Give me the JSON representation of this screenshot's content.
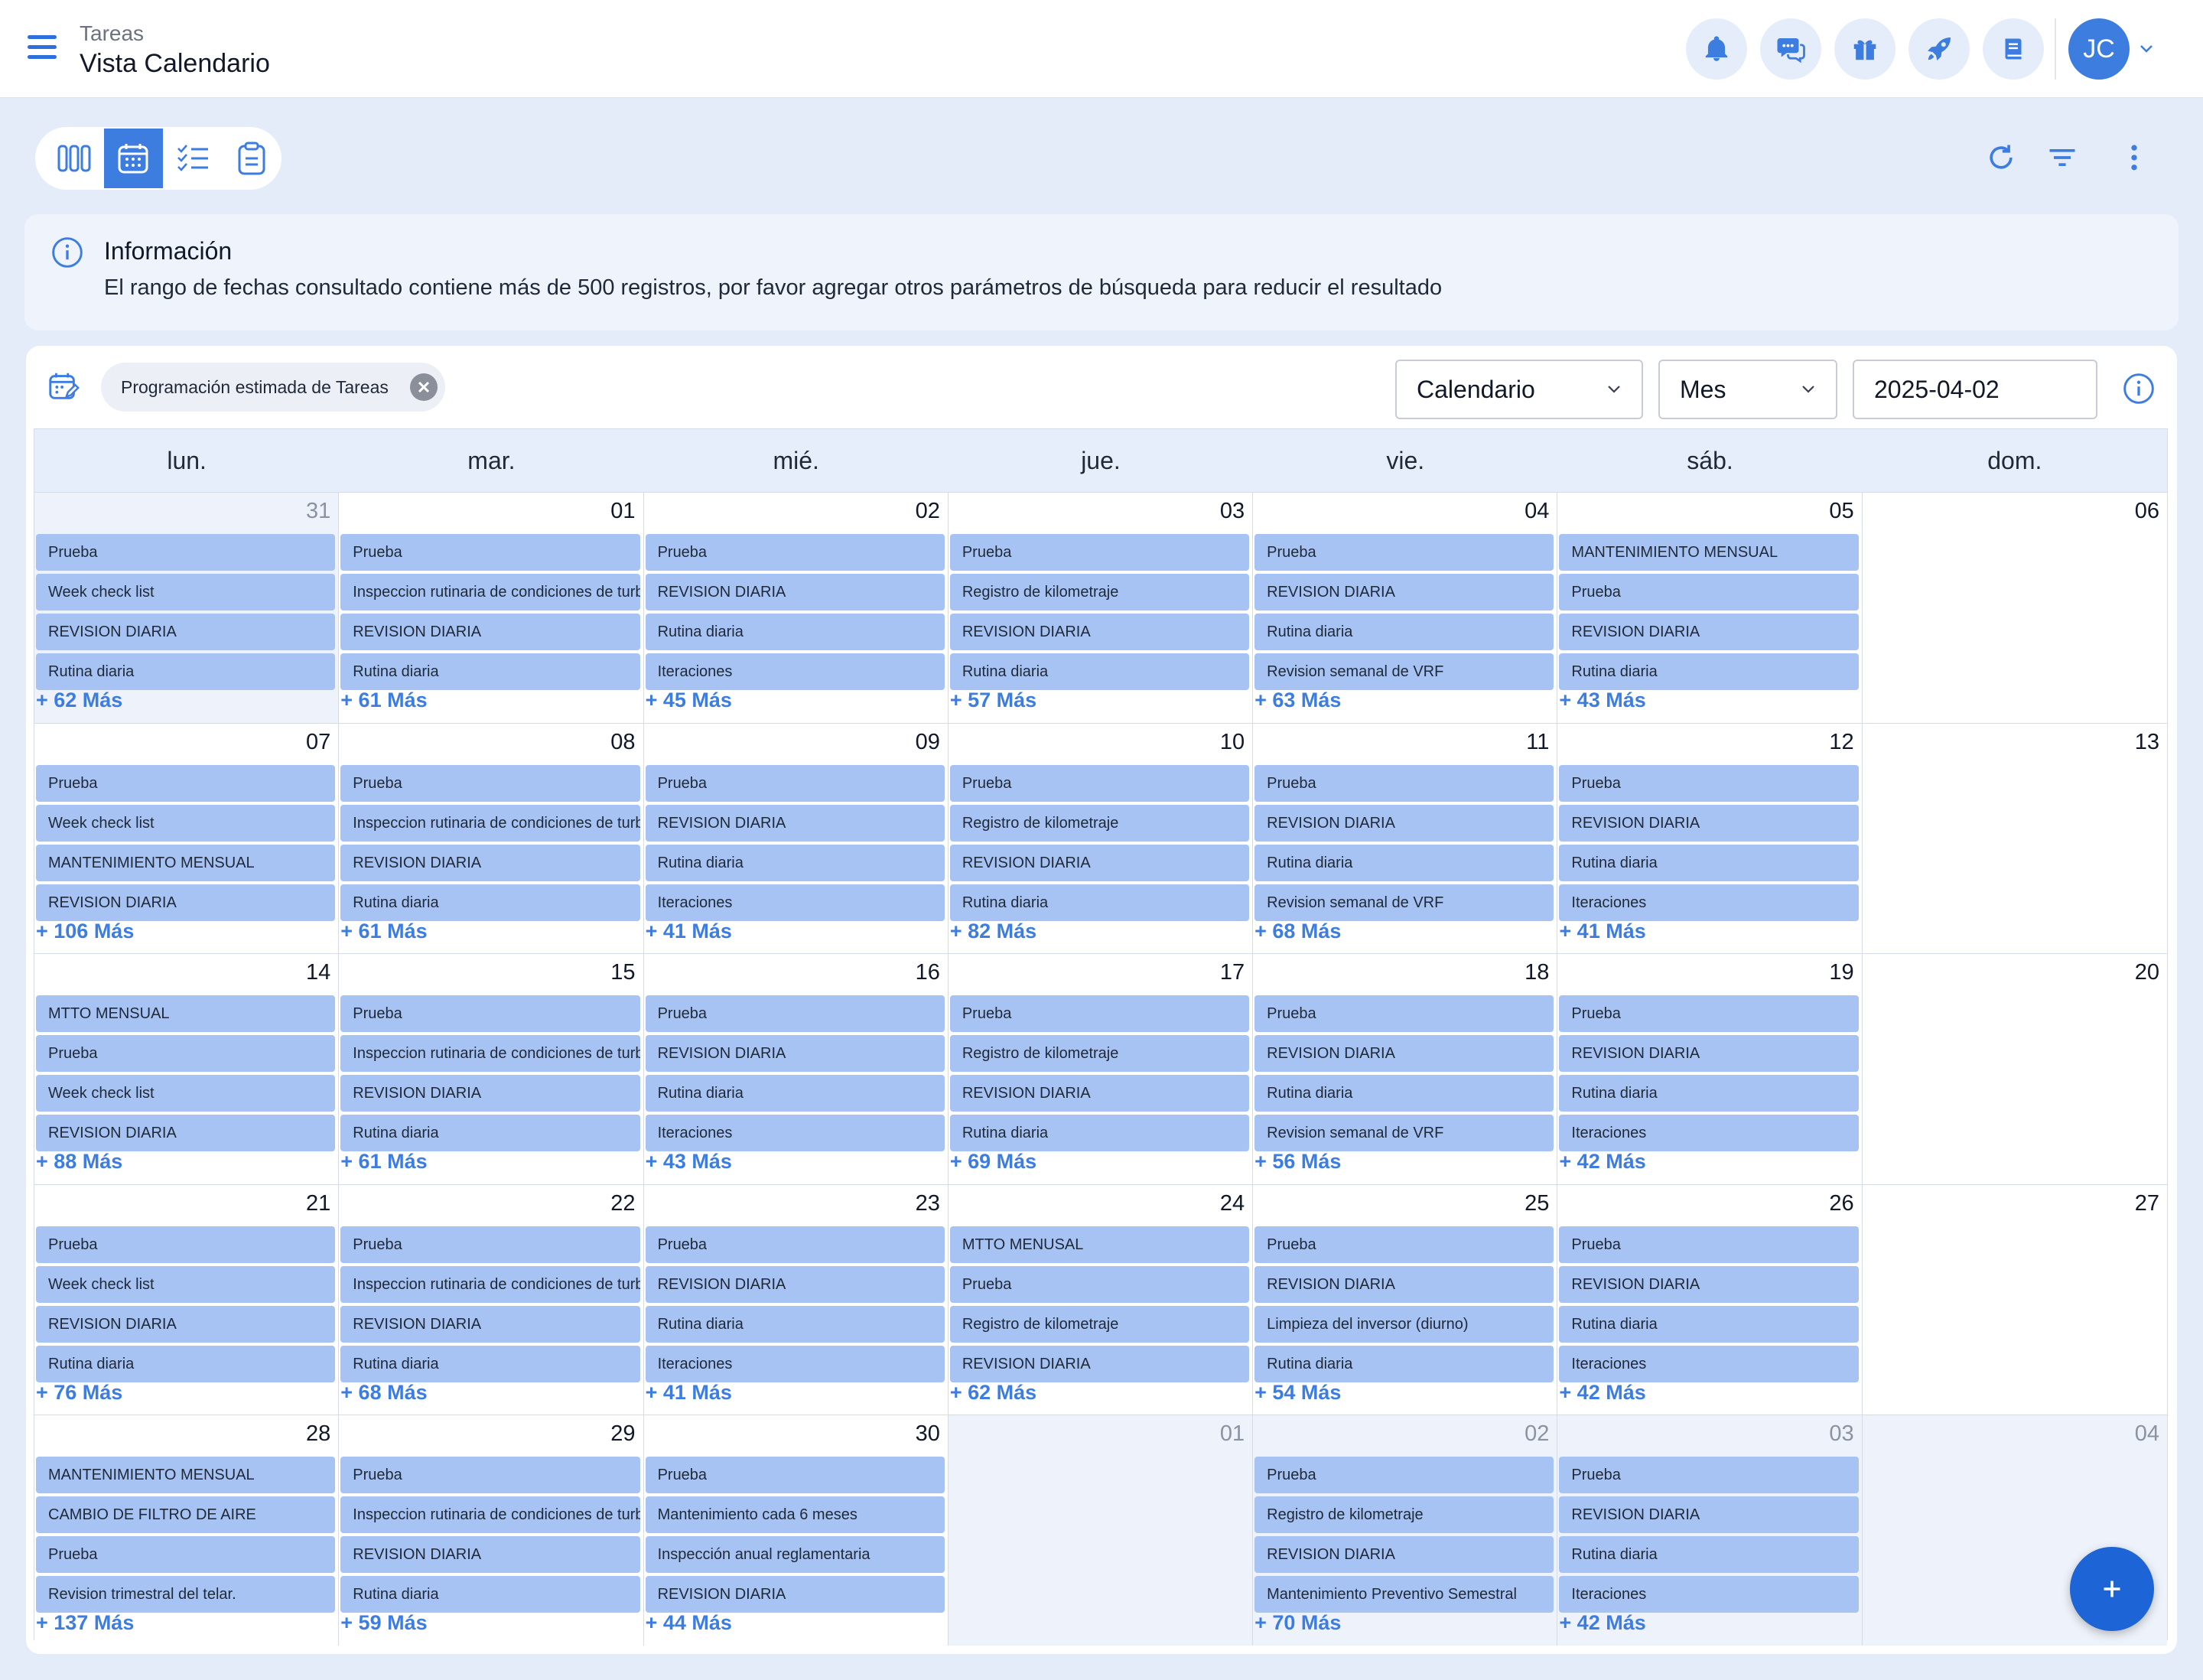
{
  "header": {
    "parent": "Tareas",
    "title": "Vista Calendario",
    "avatar_initials": "JC",
    "icons": [
      "bell-icon",
      "chat-icon",
      "gift-icon",
      "rocket-icon",
      "book-icon"
    ]
  },
  "info": {
    "title": "Información",
    "message": "El rango de fechas consultado contiene más de 500 registros, por favor agregar otros parámetros de búsqueda para reducir el resultado"
  },
  "calendar": {
    "filter_chip": "Programación estimada de Tareas",
    "view_select": "Calendario",
    "period_select": "Mes",
    "date_value": "2025-04-02",
    "weekdays": [
      "lun.",
      "mar.",
      "mié.",
      "jue.",
      "vie.",
      "sáb.",
      "dom."
    ],
    "weeks": [
      [
        {
          "day": "31",
          "outside": true,
          "events": [
            "Prueba",
            "Week check list",
            "REVISION DIARIA",
            "Rutina diaria"
          ],
          "more": "+ 62 Más"
        },
        {
          "day": "01",
          "outside": false,
          "events": [
            "Prueba",
            "Inspeccion rutinaria de condiciones de turb",
            "REVISION DIARIA",
            "Rutina diaria"
          ],
          "more": "+ 61 Más"
        },
        {
          "day": "02",
          "outside": false,
          "today": true,
          "events": [
            "Prueba",
            "REVISION DIARIA",
            "Rutina diaria",
            "Iteraciones"
          ],
          "more": "+ 45 Más"
        },
        {
          "day": "03",
          "outside": false,
          "events": [
            "Prueba",
            "Registro de kilometraje",
            "REVISION DIARIA",
            "Rutina diaria"
          ],
          "more": "+ 57 Más"
        },
        {
          "day": "04",
          "outside": false,
          "events": [
            "Prueba",
            "REVISION DIARIA",
            "Rutina diaria",
            "Revision semanal de VRF"
          ],
          "more": "+ 63 Más"
        },
        {
          "day": "05",
          "outside": false,
          "events": [
            "MANTENIMIENTO MENSUAL",
            "Prueba",
            "REVISION DIARIA",
            "Rutina diaria"
          ],
          "more": "+ 43 Más"
        },
        {
          "day": "06",
          "outside": false,
          "events": [],
          "more": ""
        }
      ],
      [
        {
          "day": "07",
          "outside": false,
          "events": [
            "Prueba",
            "Week check list",
            "MANTENIMIENTO MENSUAL",
            "REVISION DIARIA"
          ],
          "more": "+ 106 Más"
        },
        {
          "day": "08",
          "outside": false,
          "events": [
            "Prueba",
            "Inspeccion rutinaria de condiciones de turb",
            "REVISION DIARIA",
            "Rutina diaria"
          ],
          "more": "+ 61 Más"
        },
        {
          "day": "09",
          "outside": false,
          "events": [
            "Prueba",
            "REVISION DIARIA",
            "Rutina diaria",
            "Iteraciones"
          ],
          "more": "+ 41 Más"
        },
        {
          "day": "10",
          "outside": false,
          "events": [
            "Prueba",
            "Registro de kilometraje",
            "REVISION DIARIA",
            "Rutina diaria"
          ],
          "more": "+ 82 Más"
        },
        {
          "day": "11",
          "outside": false,
          "events": [
            "Prueba",
            "REVISION DIARIA",
            "Rutina diaria",
            "Revision semanal de VRF"
          ],
          "more": "+ 68 Más"
        },
        {
          "day": "12",
          "outside": false,
          "events": [
            "Prueba",
            "REVISION DIARIA",
            "Rutina diaria",
            "Iteraciones"
          ],
          "more": "+ 41 Más"
        },
        {
          "day": "13",
          "outside": false,
          "events": [],
          "more": ""
        }
      ],
      [
        {
          "day": "14",
          "outside": false,
          "events": [
            "MTTO MENSUAL",
            "Prueba",
            "Week check list",
            "REVISION DIARIA"
          ],
          "more": "+ 88 Más"
        },
        {
          "day": "15",
          "outside": false,
          "events": [
            "Prueba",
            "Inspeccion rutinaria de condiciones de turb",
            "REVISION DIARIA",
            "Rutina diaria"
          ],
          "more": "+ 61 Más"
        },
        {
          "day": "16",
          "outside": false,
          "events": [
            "Prueba",
            "REVISION DIARIA",
            "Rutina diaria",
            "Iteraciones"
          ],
          "more": "+ 43 Más"
        },
        {
          "day": "17",
          "outside": false,
          "events": [
            "Prueba",
            "Registro de kilometraje",
            "REVISION DIARIA",
            "Rutina diaria"
          ],
          "more": "+ 69 Más"
        },
        {
          "day": "18",
          "outside": false,
          "events": [
            "Prueba",
            "REVISION DIARIA",
            "Rutina diaria",
            "Revision semanal de VRF"
          ],
          "more": "+ 56 Más"
        },
        {
          "day": "19",
          "outside": false,
          "events": [
            "Prueba",
            "REVISION DIARIA",
            "Rutina diaria",
            "Iteraciones"
          ],
          "more": "+ 42 Más"
        },
        {
          "day": "20",
          "outside": false,
          "events": [],
          "more": ""
        }
      ],
      [
        {
          "day": "21",
          "outside": false,
          "events": [
            "Prueba",
            "Week check list",
            "REVISION DIARIA",
            "Rutina diaria"
          ],
          "more": "+ 76 Más"
        },
        {
          "day": "22",
          "outside": false,
          "events": [
            "Prueba",
            "Inspeccion rutinaria de condiciones de turb",
            "REVISION DIARIA",
            "Rutina diaria"
          ],
          "more": "+ 68 Más"
        },
        {
          "day": "23",
          "outside": false,
          "events": [
            "Prueba",
            "REVISION DIARIA",
            "Rutina diaria",
            "Iteraciones"
          ],
          "more": "+ 41 Más"
        },
        {
          "day": "24",
          "outside": false,
          "events": [
            "MTTO MENUSAL",
            "Prueba",
            "Registro de kilometraje",
            "REVISION DIARIA"
          ],
          "more": "+ 62 Más"
        },
        {
          "day": "25",
          "outside": false,
          "events": [
            "Prueba",
            "REVISION DIARIA",
            "Limpieza del inversor (diurno)",
            "Rutina diaria"
          ],
          "more": "+ 54 Más"
        },
        {
          "day": "26",
          "outside": false,
          "events": [
            "Prueba",
            "REVISION DIARIA",
            "Rutina diaria",
            "Iteraciones"
          ],
          "more": "+ 42 Más"
        },
        {
          "day": "27",
          "outside": false,
          "events": [],
          "more": ""
        }
      ],
      [
        {
          "day": "28",
          "outside": false,
          "events": [
            "MANTENIMIENTO MENSUAL",
            "CAMBIO DE FILTRO DE AIRE",
            "Prueba",
            "Revision trimestral del telar."
          ],
          "more": "+ 137 Más"
        },
        {
          "day": "29",
          "outside": false,
          "events": [
            "Prueba",
            "Inspeccion rutinaria de condiciones de turb",
            "REVISION DIARIA",
            "Rutina diaria"
          ],
          "more": "+ 59 Más"
        },
        {
          "day": "30",
          "outside": false,
          "events": [
            "Prueba",
            "Mantenimiento cada 6 meses",
            "Inspección anual reglamentaria",
            "REVISION DIARIA"
          ],
          "more": "+ 44 Más"
        },
        {
          "day": "01",
          "outside": true,
          "events": [],
          "more": ""
        },
        {
          "day": "02",
          "outside": true,
          "events": [
            "Prueba",
            "Registro de kilometraje",
            "REVISION DIARIA",
            "Mantenimiento Preventivo Semestral"
          ],
          "more": "+ 70 Más"
        },
        {
          "day": "03",
          "outside": true,
          "events": [
            "Prueba",
            "REVISION DIARIA",
            "Rutina diaria",
            "Iteraciones"
          ],
          "more": "+ 42 Más"
        },
        {
          "day": "04",
          "outside": true,
          "events": [],
          "more": ""
        }
      ]
    ]
  },
  "colors": {
    "accent": "#3d7de0",
    "event_bg": "#a7c3f4",
    "page_bg": "#e4ecf9",
    "fab": "#1d64d6"
  }
}
